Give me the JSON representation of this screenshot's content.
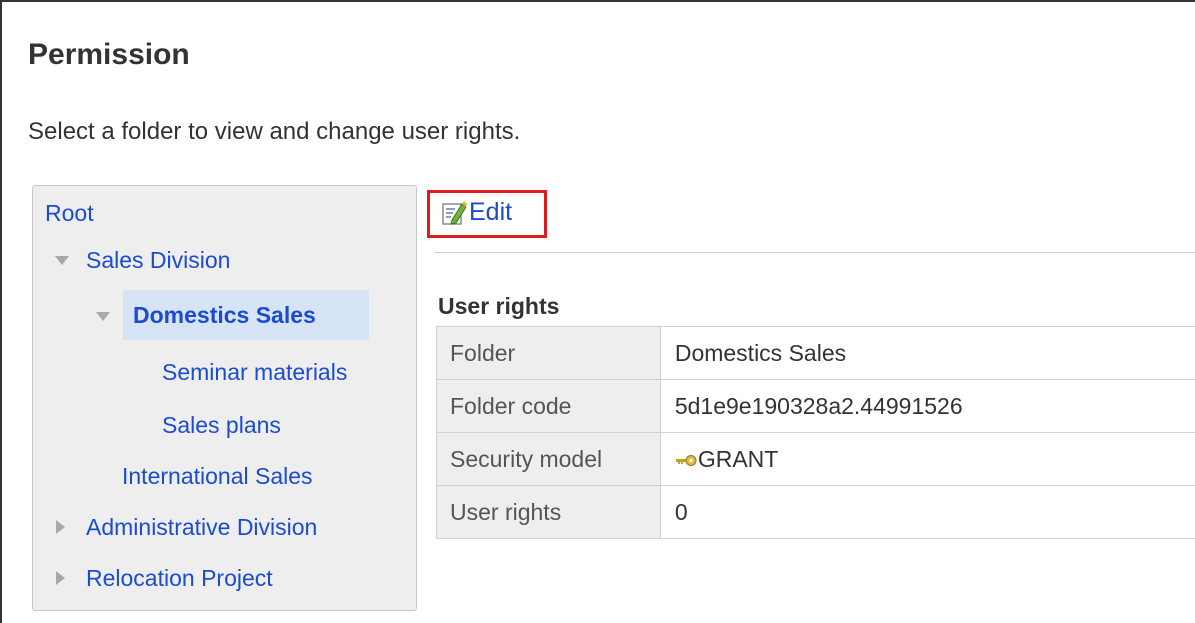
{
  "page": {
    "title": "Permission",
    "description": "Select a folder to view and change user rights."
  },
  "tree": {
    "root": "Root",
    "items": [
      {
        "label": "Sales Division",
        "expanded": true
      },
      {
        "label": "Domestics Sales",
        "expanded": true,
        "selected": true
      },
      {
        "label": "Seminar materials"
      },
      {
        "label": "Sales plans"
      },
      {
        "label": "International Sales"
      },
      {
        "label": "Administrative Division",
        "expanded": false
      },
      {
        "label": "Relocation Project",
        "expanded": false
      }
    ]
  },
  "toolbar": {
    "edit_label": "Edit",
    "edit_icon": "edit-icon"
  },
  "user_rights": {
    "heading": "User rights",
    "rows": [
      {
        "label": "Folder",
        "value": "Domestics Sales"
      },
      {
        "label": "Folder code",
        "value": "5d1e9e190328a2.44991526"
      },
      {
        "label": "Security model",
        "value": "GRANT",
        "icon": "key-icon"
      },
      {
        "label": "User rights",
        "value": "0"
      }
    ]
  },
  "colors": {
    "link": "#1b4bd1",
    "highlight_border": "#e11a22",
    "selected_bg": "#d6e4f5"
  }
}
